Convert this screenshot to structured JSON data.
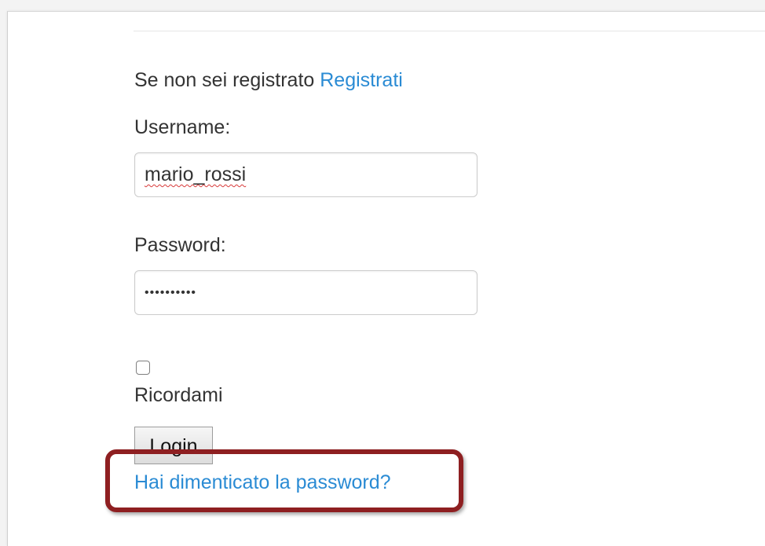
{
  "intro": {
    "text": "Se non sei registrato",
    "register_link": "Registrati"
  },
  "username": {
    "label": "Username:",
    "value": "mario_rossi"
  },
  "password": {
    "label": "Password:",
    "value": "••••••••••"
  },
  "remember": {
    "label": "Ricordami",
    "checked": false
  },
  "login_button": "Login",
  "forgot_link": "Hai dimenticato la password?",
  "colors": {
    "link": "#2a8bd4",
    "highlight_border": "#8e1f21"
  }
}
